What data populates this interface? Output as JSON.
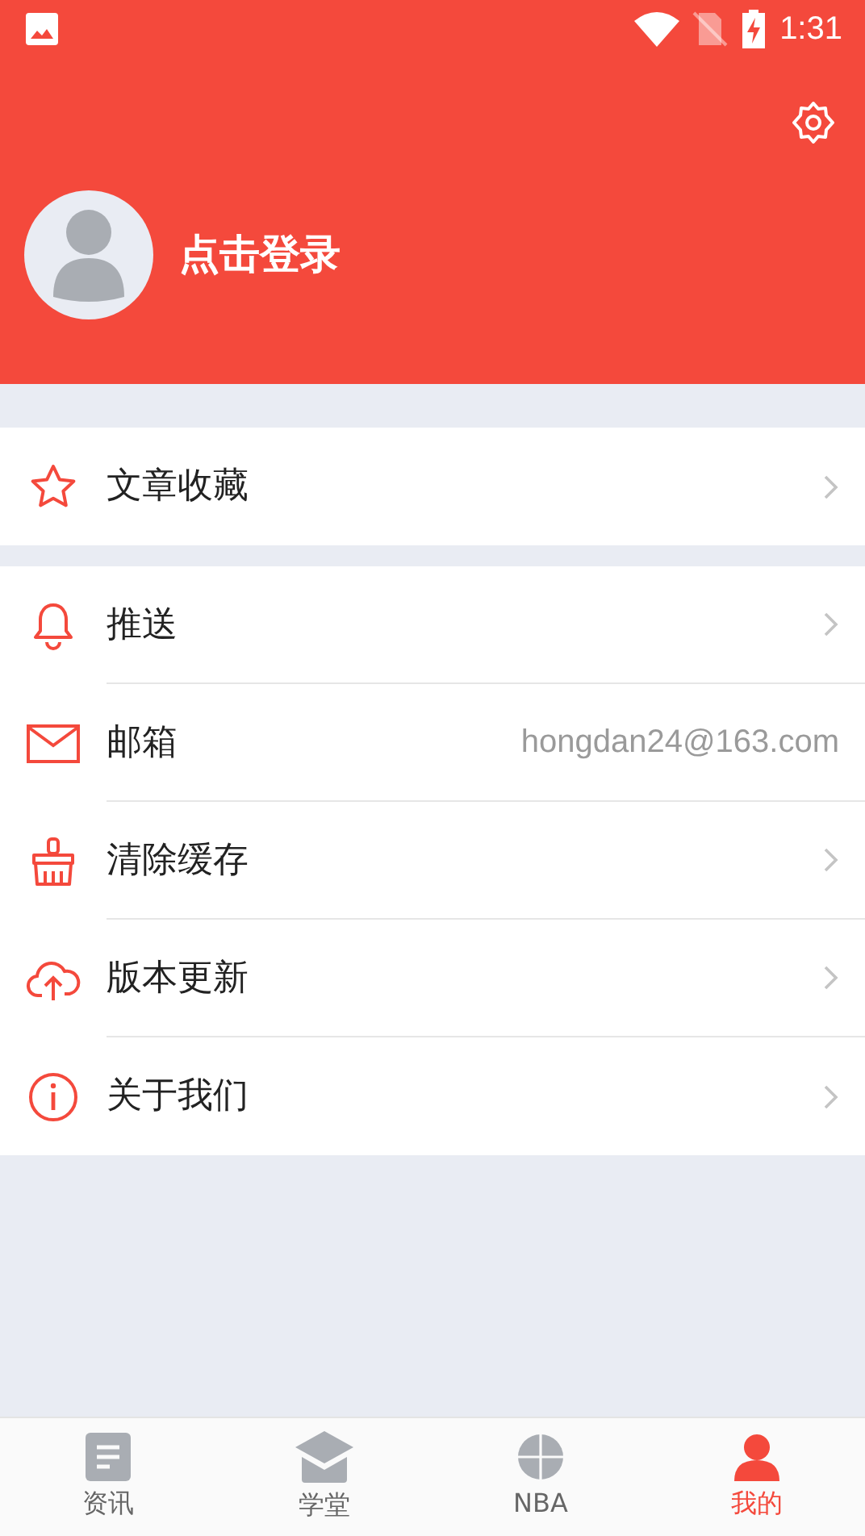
{
  "status_bar": {
    "time": "1:31"
  },
  "header": {
    "login_label": "点击登录"
  },
  "menu_groups": [
    {
      "items": [
        {
          "label": "文章收藏"
        }
      ]
    },
    {
      "items": [
        {
          "label": "推送"
        },
        {
          "label": "邮箱",
          "value": "hongdan24@163.com"
        },
        {
          "label": "清除缓存"
        },
        {
          "label": "版本更新"
        },
        {
          "label": "关于我们"
        }
      ]
    }
  ],
  "tab_bar": [
    {
      "label": "资讯",
      "selected": false
    },
    {
      "label": "学堂",
      "selected": false
    },
    {
      "label": "NBA",
      "selected": false
    },
    {
      "label": "我的",
      "selected": true
    }
  ]
}
